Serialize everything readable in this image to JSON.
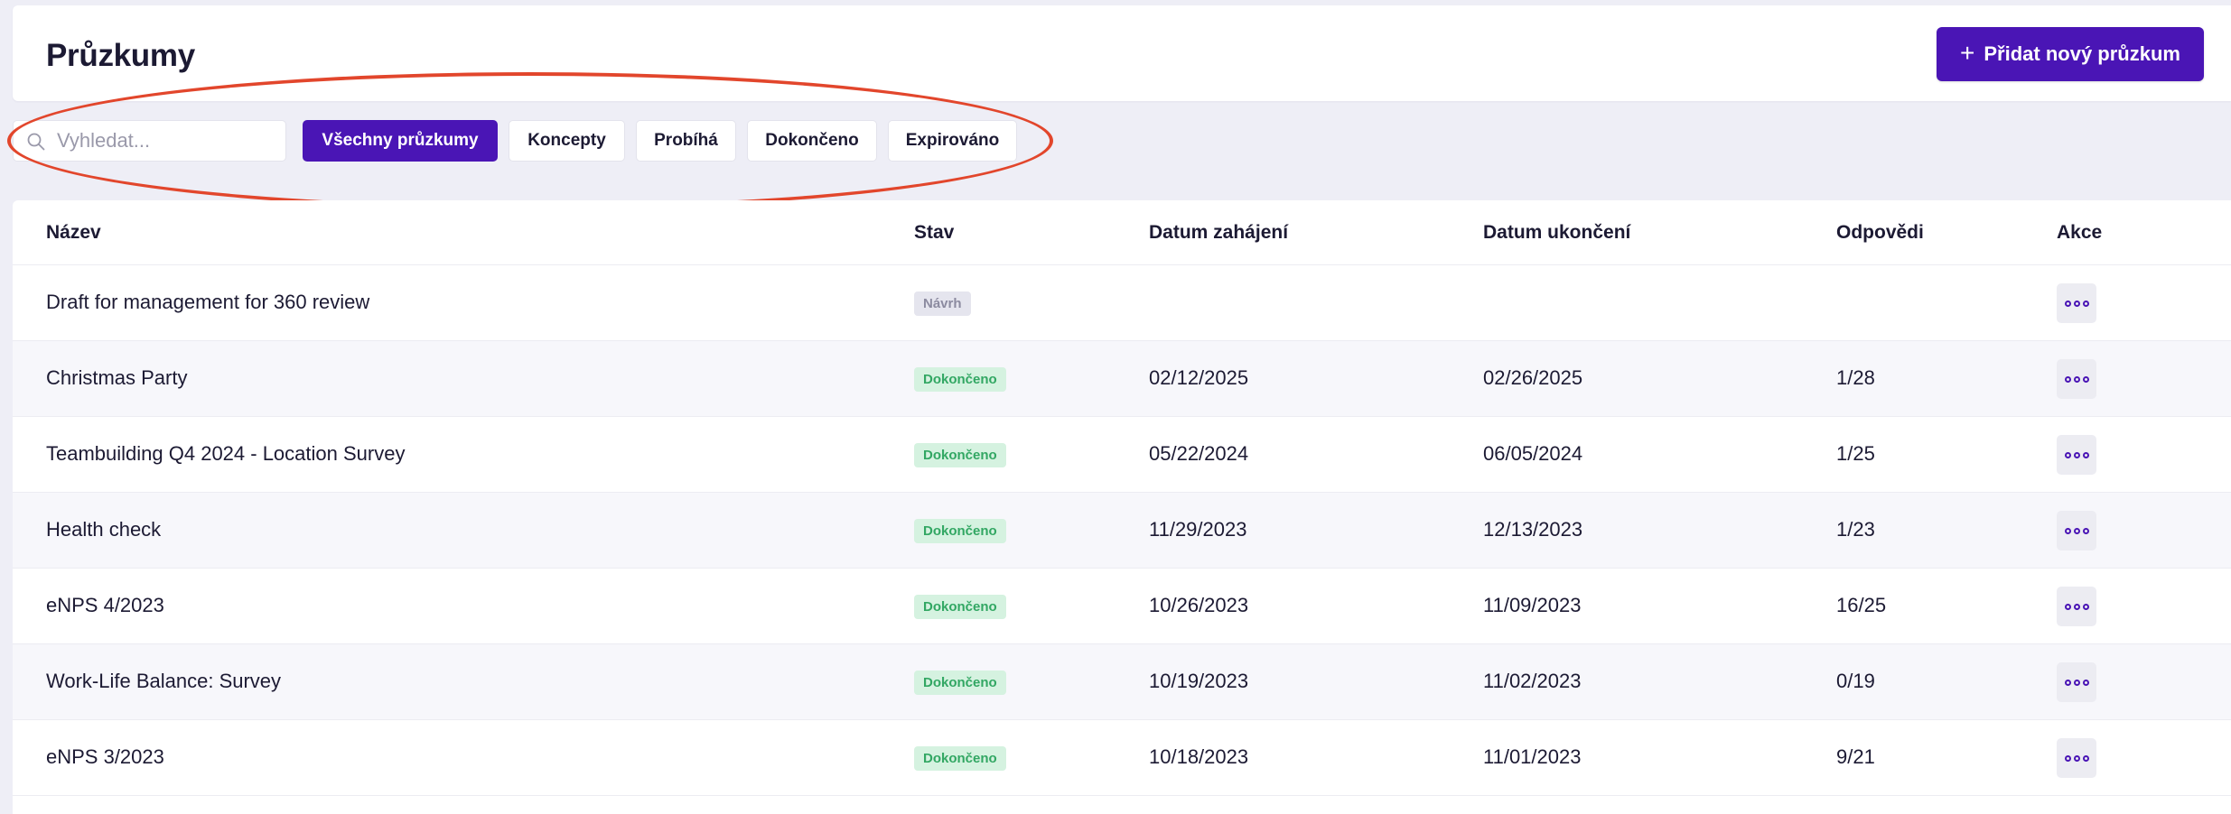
{
  "header": {
    "title": "Průzkumy",
    "add_button": {
      "plus": "+",
      "label": "Přidat nový průzkum"
    }
  },
  "filters": {
    "search_placeholder": "Vyhledat...",
    "chips": [
      {
        "label": "Všechny průzkumy",
        "active": true
      },
      {
        "label": "Koncepty",
        "active": false
      },
      {
        "label": "Probíhá",
        "active": false
      },
      {
        "label": "Dokončeno",
        "active": false
      },
      {
        "label": "Expirováno",
        "active": false
      }
    ]
  },
  "table": {
    "columns": {
      "name": "Název",
      "status": "Stav",
      "start": "Datum zahájení",
      "end": "Datum ukončení",
      "responses": "Odpovědi",
      "actions": "Akce"
    },
    "rows": [
      {
        "name": "Draft for management for 360 review",
        "status": "Návrh",
        "status_type": "draft",
        "start": "",
        "end": "",
        "responses": ""
      },
      {
        "name": "Christmas Party",
        "status": "Dokončeno",
        "status_type": "done",
        "start": "02/12/2025",
        "end": "02/26/2025",
        "responses": "1/28"
      },
      {
        "name": "Teambuilding Q4 2024 - Location Survey",
        "status": "Dokončeno",
        "status_type": "done",
        "start": "05/22/2024",
        "end": "06/05/2024",
        "responses": "1/25"
      },
      {
        "name": "Health check",
        "status": "Dokončeno",
        "status_type": "done",
        "start": "11/29/2023",
        "end": "12/13/2023",
        "responses": "1/23"
      },
      {
        "name": "eNPS 4/2023",
        "status": "Dokončeno",
        "status_type": "done",
        "start": "10/26/2023",
        "end": "11/09/2023",
        "responses": "16/25"
      },
      {
        "name": "Work-Life Balance: Survey",
        "status": "Dokončeno",
        "status_type": "done",
        "start": "10/19/2023",
        "end": "11/02/2023",
        "responses": "0/19"
      },
      {
        "name": "eNPS 3/2023",
        "status": "Dokončeno",
        "status_type": "done",
        "start": "10/18/2023",
        "end": "11/01/2023",
        "responses": "9/21"
      }
    ]
  },
  "colors": {
    "accent": "#4a15b5",
    "annotation": "#e2462c",
    "done_bg": "#d5f2e0",
    "done_text": "#32a763"
  }
}
